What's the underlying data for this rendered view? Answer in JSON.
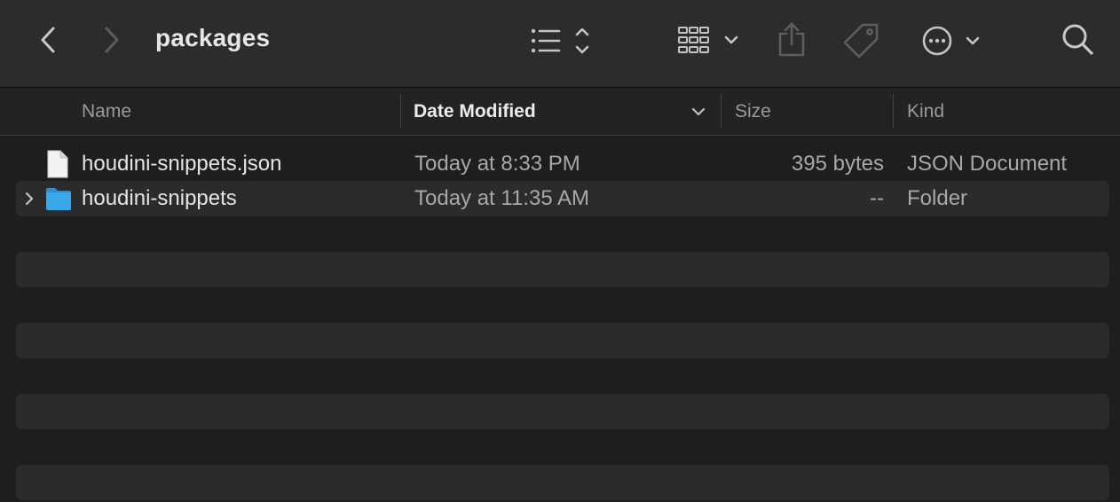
{
  "window": {
    "title": "packages"
  },
  "toolbar": {
    "back_icon": "chevron-left-icon",
    "forward_icon": "chevron-right-icon",
    "view_options_icon": "list-view-icon",
    "group_icon": "grid-group-icon",
    "share_icon": "share-icon",
    "tag_icon": "tag-icon",
    "more_icon": "ellipsis-circle-icon",
    "search_icon": "search-icon"
  },
  "columns": {
    "name": "Name",
    "date_modified": "Date Modified",
    "size": "Size",
    "kind": "Kind",
    "sorted_by": "date_modified"
  },
  "files": [
    {
      "name": "houdini-snippets.json",
      "date_modified": "Today at 8:33 PM",
      "size": "395 bytes",
      "kind": "JSON Document",
      "icon": "document-icon",
      "expandable": false
    },
    {
      "name": "houdini-snippets",
      "date_modified": "Today at 11:35 AM",
      "size": "--",
      "kind": "Folder",
      "icon": "folder-icon",
      "expandable": true
    }
  ],
  "colors": {
    "toolbar_bg": "#2c2c2c",
    "content_bg": "#1e1e1e",
    "stripe_bg": "#2b2b2b",
    "folder_blue": "#3aa7e8",
    "text_primary": "#e4e4e4",
    "text_secondary": "#a8a8a8"
  }
}
